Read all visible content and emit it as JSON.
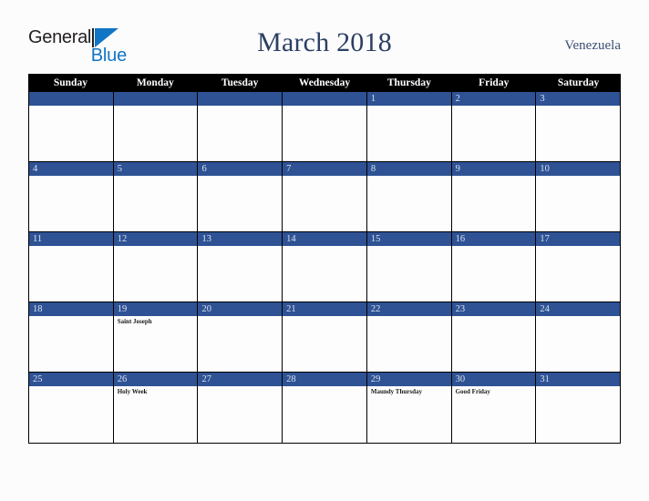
{
  "brand": {
    "name_part1": "General",
    "name_part2": "Blue",
    "mark": "triangle-icon",
    "color_dark": "#231f20",
    "color_blue": "#1275c4"
  },
  "header": {
    "title": "March 2018",
    "region": "Venezuela"
  },
  "calendar": {
    "accent_color": "#2e5294",
    "header_bg": "#000000",
    "day_names": [
      "Sunday",
      "Monday",
      "Tuesday",
      "Wednesday",
      "Thursday",
      "Friday",
      "Saturday"
    ],
    "weeks": [
      [
        {
          "num": "",
          "blank": true,
          "events": []
        },
        {
          "num": "",
          "blank": true,
          "events": []
        },
        {
          "num": "",
          "blank": true,
          "events": []
        },
        {
          "num": "",
          "blank": true,
          "events": []
        },
        {
          "num": "1",
          "blank": false,
          "events": []
        },
        {
          "num": "2",
          "blank": false,
          "events": []
        },
        {
          "num": "3",
          "blank": false,
          "events": []
        }
      ],
      [
        {
          "num": "4",
          "blank": false,
          "events": []
        },
        {
          "num": "5",
          "blank": false,
          "events": []
        },
        {
          "num": "6",
          "blank": false,
          "events": []
        },
        {
          "num": "7",
          "blank": false,
          "events": []
        },
        {
          "num": "8",
          "blank": false,
          "events": []
        },
        {
          "num": "9",
          "blank": false,
          "events": []
        },
        {
          "num": "10",
          "blank": false,
          "events": []
        }
      ],
      [
        {
          "num": "11",
          "blank": false,
          "events": []
        },
        {
          "num": "12",
          "blank": false,
          "events": []
        },
        {
          "num": "13",
          "blank": false,
          "events": []
        },
        {
          "num": "14",
          "blank": false,
          "events": []
        },
        {
          "num": "15",
          "blank": false,
          "events": []
        },
        {
          "num": "16",
          "blank": false,
          "events": []
        },
        {
          "num": "17",
          "blank": false,
          "events": []
        }
      ],
      [
        {
          "num": "18",
          "blank": false,
          "events": []
        },
        {
          "num": "19",
          "blank": false,
          "events": [
            "Saint Joseph"
          ]
        },
        {
          "num": "20",
          "blank": false,
          "events": []
        },
        {
          "num": "21",
          "blank": false,
          "events": []
        },
        {
          "num": "22",
          "blank": false,
          "events": []
        },
        {
          "num": "23",
          "blank": false,
          "events": []
        },
        {
          "num": "24",
          "blank": false,
          "events": []
        }
      ],
      [
        {
          "num": "25",
          "blank": false,
          "events": []
        },
        {
          "num": "26",
          "blank": false,
          "events": [
            "Holy Week"
          ]
        },
        {
          "num": "27",
          "blank": false,
          "events": []
        },
        {
          "num": "28",
          "blank": false,
          "events": []
        },
        {
          "num": "29",
          "blank": false,
          "events": [
            "Maundy Thursday"
          ]
        },
        {
          "num": "30",
          "blank": false,
          "events": [
            "Good Friday"
          ]
        },
        {
          "num": "31",
          "blank": false,
          "events": []
        }
      ]
    ]
  }
}
